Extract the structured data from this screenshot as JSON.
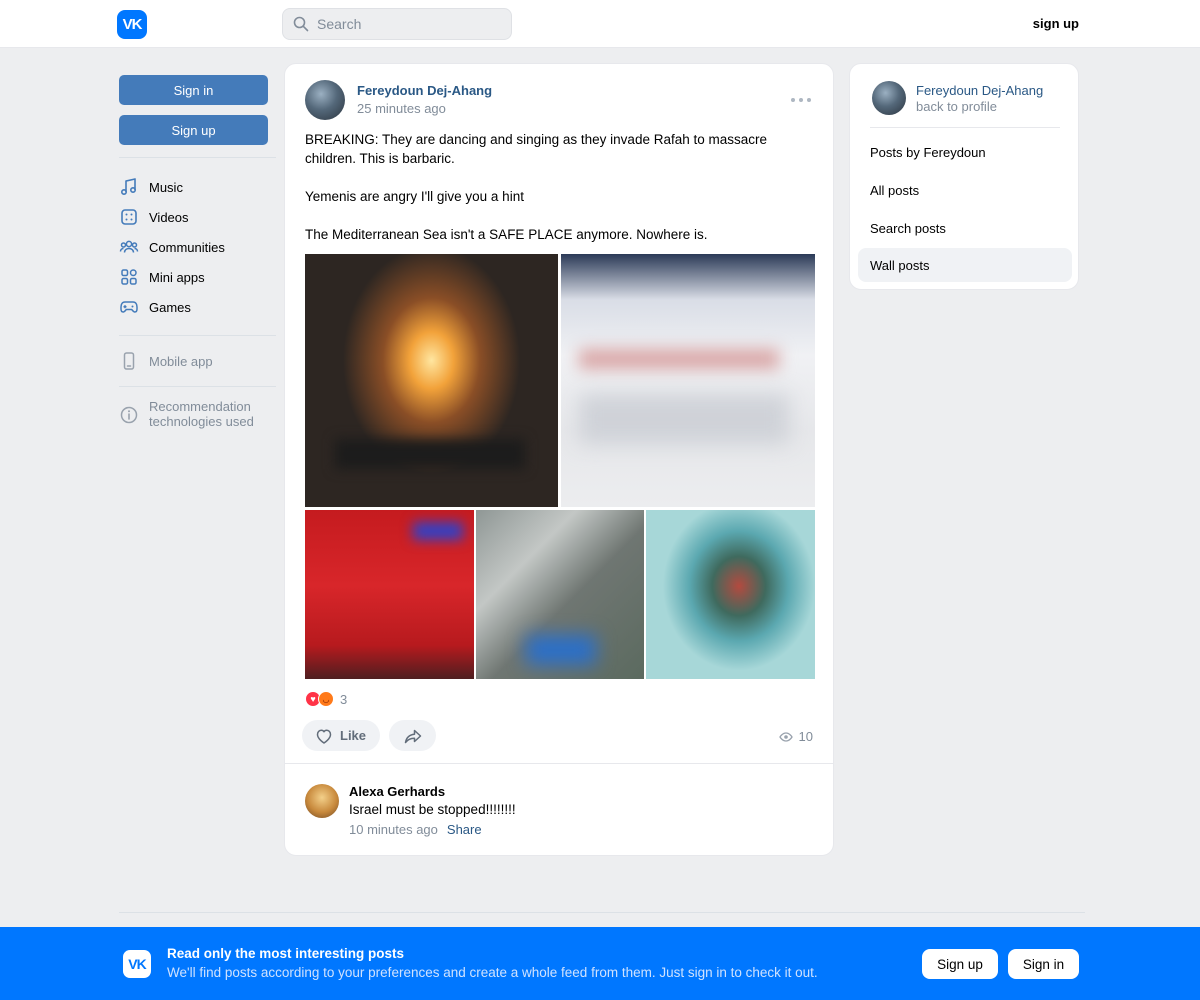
{
  "header": {
    "logo_text": "VK",
    "search_placeholder": "Search",
    "signup_label": "sign up"
  },
  "leftnav": {
    "signin_label": "Sign in",
    "signup_label": "Sign up",
    "items": [
      {
        "label": "Music",
        "icon": "music-icon"
      },
      {
        "label": "Videos",
        "icon": "video-icon"
      },
      {
        "label": "Communities",
        "icon": "communities-icon"
      },
      {
        "label": "Mini apps",
        "icon": "mini-apps-icon"
      },
      {
        "label": "Games",
        "icon": "gamepad-icon"
      }
    ],
    "mobile_label": "Mobile app",
    "recommendation_label": "Recommendation technologies used"
  },
  "post": {
    "author": "Fereydoun Dej-Ahang",
    "time": "25 minutes ago",
    "text": "BREAKING: They are dancing and singing as they invade Rafah to massacre children. This is barbaric.\n\nYemenis are angry I'll give you a hint\n\nThe Mediterranean Sea isn't a SAFE PLACE anymore. Nowhere is.",
    "reactions_count": "3",
    "like_label": "Like",
    "views": "10"
  },
  "comment": {
    "author": "Alexa Gerhards",
    "text": "Israel must be stopped!!!!!!!!",
    "time": "10 minutes ago",
    "share_label": "Share"
  },
  "side": {
    "name": "Fereydoun Dej-Ahang",
    "back_label": "back to profile",
    "items": [
      "Posts by Fereydoun",
      "All posts",
      "Search posts",
      "Wall posts"
    ]
  },
  "banner": {
    "logo_text": "VK",
    "title": "Read only the most interesting posts",
    "subtitle": "We'll find posts according to your preferences and create a whole feed from them. Just sign in to check it out.",
    "signup_label": "Sign up",
    "signin_label": "Sign in"
  },
  "colors": {
    "brand": "#0077ff",
    "link": "#2a5885",
    "button": "#447bba",
    "muted": "#818c99",
    "background": "#edeef0"
  }
}
